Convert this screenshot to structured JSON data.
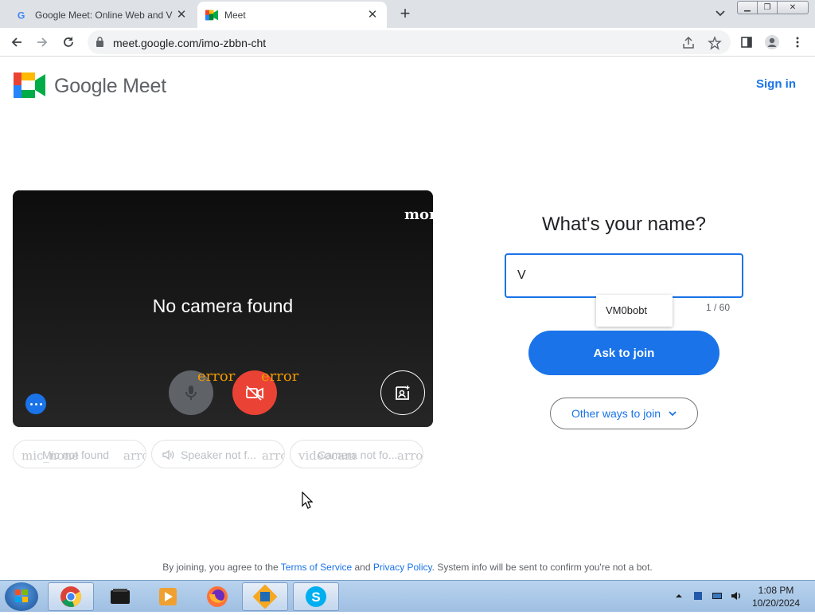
{
  "browser": {
    "tabs": [
      {
        "title": "Google Meet: Online Web and V",
        "favicon": "google-g-icon",
        "active": false
      },
      {
        "title": "Meet",
        "favicon": "google-meet-icon",
        "active": true
      }
    ],
    "url": "meet.google.com/imo-zbbn-cht"
  },
  "page": {
    "brand": "Google Meet",
    "sign_in": "Sign in",
    "preview": {
      "corner_text": "more",
      "no_camera": "No camera found",
      "mic_error": "error",
      "cam_error": "error"
    },
    "device_chips": [
      {
        "alt": "mic_none",
        "label": "Mic not found",
        "arrow": "arro"
      },
      {
        "alt": "",
        "label": "Speaker not f...",
        "arrow": "arro"
      },
      {
        "alt": "videocam",
        "label": "Camera not fo...",
        "arrow": "arro"
      }
    ],
    "join": {
      "question": "What's your name?",
      "name_value": "V",
      "suggestion": "VM0bobt",
      "counter": "1 / 60",
      "ask_to_join": "Ask to join",
      "other_ways": "Other ways to join"
    },
    "footer": {
      "prefix": "By joining, you agree to the",
      "terms": "Terms of Service",
      "and": "and",
      "privacy": "Privacy Policy",
      "suffix": ". System info will be sent to confirm you're not a bot."
    }
  },
  "taskbar": {
    "time": "1:08 PM",
    "date": "10/20/2024"
  },
  "colors": {
    "accent": "#1a73e8",
    "cam_off_red": "#ea4335",
    "error_orange": "#f29900"
  }
}
